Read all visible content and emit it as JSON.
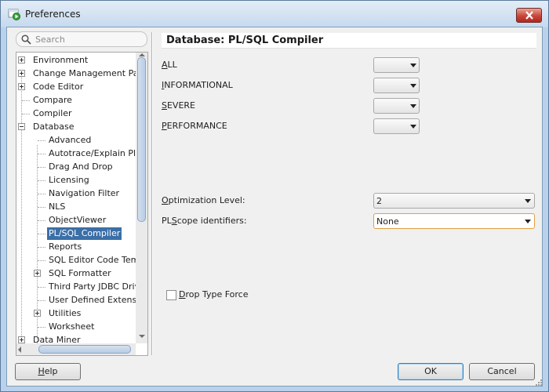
{
  "window": {
    "title": "Preferences"
  },
  "search": {
    "placeholder": "Search",
    "value": ""
  },
  "tree": {
    "items": [
      {
        "label": "Environment",
        "toggle": "plus"
      },
      {
        "label": "Change Management Parar",
        "toggle": "plus"
      },
      {
        "label": "Code Editor",
        "toggle": "plus"
      },
      {
        "label": "Compare",
        "toggle": ""
      },
      {
        "label": "Compiler",
        "toggle": ""
      },
      {
        "label": "Database",
        "toggle": "minus"
      },
      {
        "label": "Advanced",
        "toggle": ""
      },
      {
        "label": "Autotrace/Explain Plan",
        "toggle": ""
      },
      {
        "label": "Drag And Drop",
        "toggle": ""
      },
      {
        "label": "Licensing",
        "toggle": ""
      },
      {
        "label": "Navigation Filter",
        "toggle": ""
      },
      {
        "label": "NLS",
        "toggle": ""
      },
      {
        "label": "ObjectViewer",
        "toggle": ""
      },
      {
        "label": "PL/SQL Compiler",
        "toggle": "",
        "selected": true
      },
      {
        "label": "Reports",
        "toggle": ""
      },
      {
        "label": "SQL Editor Code Templa",
        "toggle": ""
      },
      {
        "label": "SQL Formatter",
        "toggle": "plus"
      },
      {
        "label": "Third Party JDBC Driver",
        "toggle": ""
      },
      {
        "label": "User Defined Extension",
        "toggle": ""
      },
      {
        "label": "Utilities",
        "toggle": "plus"
      },
      {
        "label": "Worksheet",
        "toggle": ""
      },
      {
        "label": "Data Miner",
        "toggle": "plus"
      }
    ]
  },
  "panel": {
    "title": "Database: PL/SQL Compiler",
    "warnings": [
      {
        "mnemonic": "A",
        "rest": "LL",
        "value": ""
      },
      {
        "mnemonic": "I",
        "rest": "NFORMATIONAL",
        "value": ""
      },
      {
        "mnemonic": "S",
        "rest": "EVERE",
        "value": ""
      },
      {
        "mnemonic": "P",
        "rest": "ERFORMANCE",
        "value": ""
      }
    ],
    "optimization": {
      "mnemonic": "O",
      "rest": "ptimization Level:",
      "value": "2"
    },
    "plscope": {
      "pre": "PL",
      "mnemonic": "S",
      "rest": "cope identifiers:",
      "value": "None"
    },
    "drop_type": {
      "mnemonic": "D",
      "rest": "rop Type Force",
      "checked": false
    }
  },
  "buttons": {
    "help": {
      "mnemonic": "H",
      "rest": "elp"
    },
    "ok": "OK",
    "cancel": "Cancel"
  }
}
